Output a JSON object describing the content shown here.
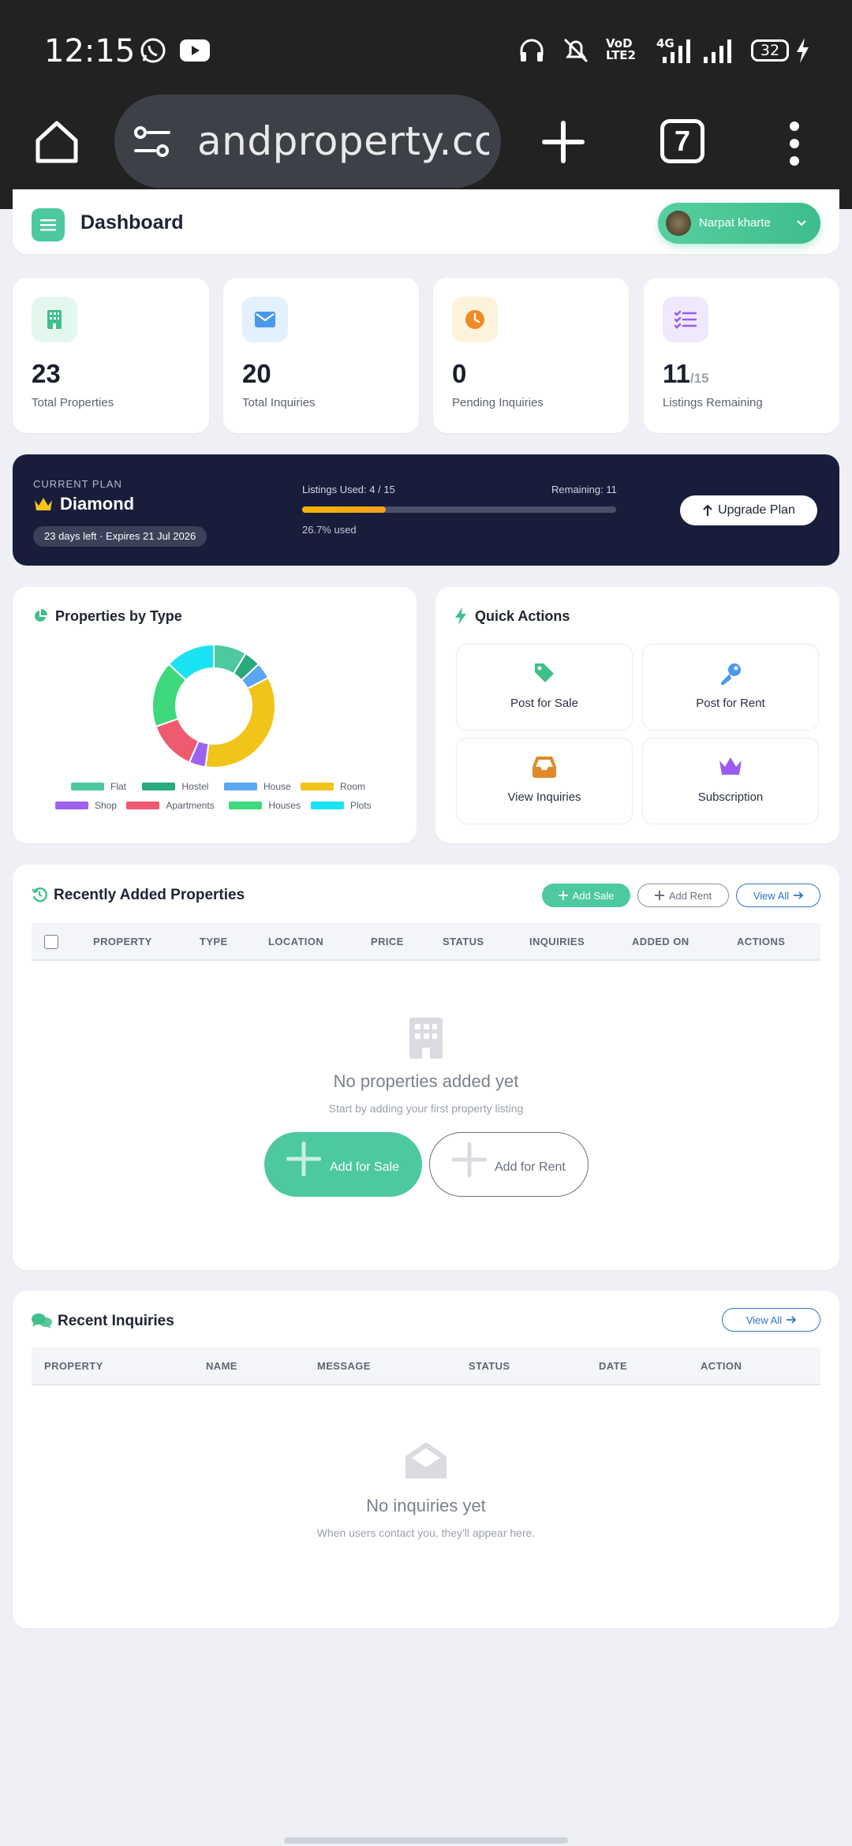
{
  "status_bar": {
    "time": "12:15",
    "battery": "32"
  },
  "browser": {
    "url": "andproperty.com",
    "tab_count": "7"
  },
  "header": {
    "title": "Dashboard",
    "user_name": "Narpat kharte"
  },
  "stats": [
    {
      "value": "23",
      "label": "Total Properties",
      "suffix": ""
    },
    {
      "value": "20",
      "label": "Total Inquiries",
      "suffix": ""
    },
    {
      "value": "0",
      "label": "Pending Inquiries",
      "suffix": ""
    },
    {
      "value": "11",
      "label": "Listings Remaining",
      "suffix": "/15"
    }
  ],
  "plan": {
    "label": "CURRENT PLAN",
    "name": "Diamond",
    "expiry": "23 days left · Expires 21 Jul 2026",
    "listings_used": "Listings Used: 4 / 15",
    "remaining": "Remaining: 11",
    "used_text": "26.7% used",
    "used_fraction": 0.267,
    "upgrade_label": "Upgrade Plan"
  },
  "properties_by_type": {
    "title": "Properties by Type"
  },
  "chart_data": {
    "type": "pie",
    "categories": [
      "Flat",
      "Hostel",
      "House",
      "Room",
      "Shop",
      "Apartments",
      "Houses",
      "Plots"
    ],
    "values": [
      2,
      1,
      1,
      8,
      1,
      3,
      4,
      3
    ],
    "colors": [
      "#4cc99e",
      "#2aa97c",
      "#5aa6f0",
      "#f0c419",
      "#9d63f0",
      "#ee5a6f",
      "#3ed97c",
      "#19e3f2"
    ],
    "legend_placement": "bottom"
  },
  "quick_actions": {
    "title": "Quick Actions",
    "items": [
      {
        "label": "Post for Sale"
      },
      {
        "label": "Post for Rent"
      },
      {
        "label": "View Inquiries"
      },
      {
        "label": "Subscription"
      }
    ]
  },
  "recent_properties": {
    "title": "Recently Added Properties",
    "add_sale": "Add Sale",
    "add_rent": "Add Rent",
    "view_all": "View All",
    "columns": [
      "PROPERTY",
      "TYPE",
      "LOCATION",
      "PRICE",
      "STATUS",
      "INQUIRIES",
      "ADDED ON",
      "ACTIONS"
    ],
    "empty_title": "No properties added yet",
    "empty_sub": "Start by adding your first property listing",
    "empty_sale_btn": "Add for Sale",
    "empty_rent_btn": "Add for Rent"
  },
  "recent_inquiries": {
    "title": "Recent Inquiries",
    "view_all": "View All",
    "columns": [
      "PROPERTY",
      "NAME",
      "MESSAGE",
      "STATUS",
      "DATE",
      "ACTION"
    ],
    "empty_title": "No inquiries yet",
    "empty_sub": "When users contact you, they'll appear here."
  }
}
